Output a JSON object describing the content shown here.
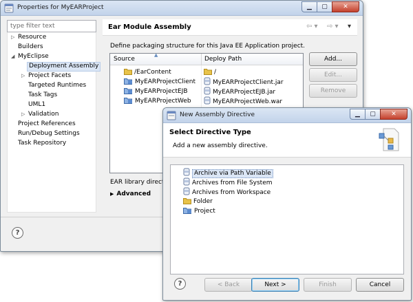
{
  "main_window": {
    "title": "Properties for MyEARProject",
    "filter_placeholder": "type filter text",
    "nav_items": [
      {
        "label": "Resource",
        "expander": "▷"
      },
      {
        "label": "Builders",
        "expander": ""
      },
      {
        "label": "MyEclipse",
        "expander": "◢"
      },
      {
        "label": "Deployment Assembly",
        "expander": ""
      },
      {
        "label": "Project Facets",
        "expander": "▷"
      },
      {
        "label": "Targeted Runtimes",
        "expander": ""
      },
      {
        "label": "Task Tags",
        "expander": ""
      },
      {
        "label": "UML1",
        "expander": ""
      },
      {
        "label": "Validation",
        "expander": "▷"
      },
      {
        "label": "Project References",
        "expander": ""
      },
      {
        "label": "Run/Debug Settings",
        "expander": ""
      },
      {
        "label": "Task Repository",
        "expander": ""
      }
    ],
    "section_title": "Ear Module Assembly",
    "description": "Define packaging structure for this Java EE Application project.",
    "columns": {
      "source": "Source",
      "deploy_path": "Deploy Path"
    },
    "rows": [
      {
        "source": "/EarContent",
        "deploy": "/"
      },
      {
        "source": "MyEARProjectClient",
        "deploy": "MyEARProjectClient.jar"
      },
      {
        "source": "MyEARProjectEJB",
        "deploy": "MyEARProjectEJB.jar"
      },
      {
        "source": "MyEARProjectWeb",
        "deploy": "MyEARProjectWeb.war"
      }
    ],
    "buttons": {
      "add": "Add...",
      "edit": "Edit...",
      "remove": "Remove"
    },
    "ear_library_label": "EAR library director",
    "advanced_label": "Advanced"
  },
  "dialog": {
    "title": "New Assembly Directive",
    "heading": "Select Directive Type",
    "subheading": "Add a new assembly directive.",
    "options": [
      {
        "label": "Archive via Path Variable",
        "icon": "jar-icon"
      },
      {
        "label": "Archives from File System",
        "icon": "jar-icon"
      },
      {
        "label": "Archives from Workspace",
        "icon": "jar-icon"
      },
      {
        "label": "Folder",
        "icon": "folder-icon"
      },
      {
        "label": "Project",
        "icon": "project-icon"
      }
    ],
    "buttons": {
      "back": "< Back",
      "next": "Next >",
      "finish": "Finish",
      "cancel": "Cancel"
    }
  },
  "colors": {
    "accent": "#3c7fb1",
    "selection": "#dbe6f5",
    "folder": "#e8c34a"
  }
}
